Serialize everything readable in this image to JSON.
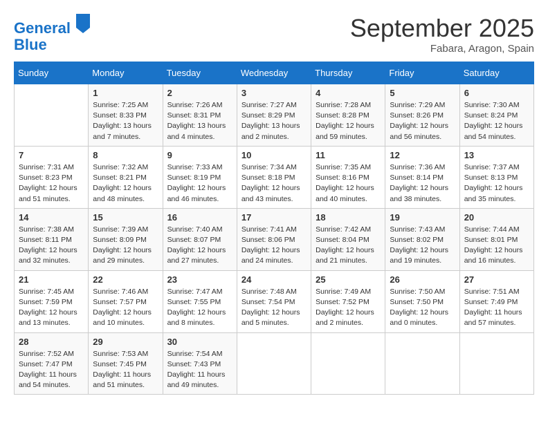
{
  "header": {
    "logo_line1": "General",
    "logo_line2": "Blue",
    "month": "September 2025",
    "location": "Fabara, Aragon, Spain"
  },
  "days_of_week": [
    "Sunday",
    "Monday",
    "Tuesday",
    "Wednesday",
    "Thursday",
    "Friday",
    "Saturday"
  ],
  "weeks": [
    [
      {
        "day": "",
        "info": ""
      },
      {
        "day": "1",
        "info": "Sunrise: 7:25 AM\nSunset: 8:33 PM\nDaylight: 13 hours\nand 7 minutes."
      },
      {
        "day": "2",
        "info": "Sunrise: 7:26 AM\nSunset: 8:31 PM\nDaylight: 13 hours\nand 4 minutes."
      },
      {
        "day": "3",
        "info": "Sunrise: 7:27 AM\nSunset: 8:29 PM\nDaylight: 13 hours\nand 2 minutes."
      },
      {
        "day": "4",
        "info": "Sunrise: 7:28 AM\nSunset: 8:28 PM\nDaylight: 12 hours\nand 59 minutes."
      },
      {
        "day": "5",
        "info": "Sunrise: 7:29 AM\nSunset: 8:26 PM\nDaylight: 12 hours\nand 56 minutes."
      },
      {
        "day": "6",
        "info": "Sunrise: 7:30 AM\nSunset: 8:24 PM\nDaylight: 12 hours\nand 54 minutes."
      }
    ],
    [
      {
        "day": "7",
        "info": "Sunrise: 7:31 AM\nSunset: 8:23 PM\nDaylight: 12 hours\nand 51 minutes."
      },
      {
        "day": "8",
        "info": "Sunrise: 7:32 AM\nSunset: 8:21 PM\nDaylight: 12 hours\nand 48 minutes."
      },
      {
        "day": "9",
        "info": "Sunrise: 7:33 AM\nSunset: 8:19 PM\nDaylight: 12 hours\nand 46 minutes."
      },
      {
        "day": "10",
        "info": "Sunrise: 7:34 AM\nSunset: 8:18 PM\nDaylight: 12 hours\nand 43 minutes."
      },
      {
        "day": "11",
        "info": "Sunrise: 7:35 AM\nSunset: 8:16 PM\nDaylight: 12 hours\nand 40 minutes."
      },
      {
        "day": "12",
        "info": "Sunrise: 7:36 AM\nSunset: 8:14 PM\nDaylight: 12 hours\nand 38 minutes."
      },
      {
        "day": "13",
        "info": "Sunrise: 7:37 AM\nSunset: 8:13 PM\nDaylight: 12 hours\nand 35 minutes."
      }
    ],
    [
      {
        "day": "14",
        "info": "Sunrise: 7:38 AM\nSunset: 8:11 PM\nDaylight: 12 hours\nand 32 minutes."
      },
      {
        "day": "15",
        "info": "Sunrise: 7:39 AM\nSunset: 8:09 PM\nDaylight: 12 hours\nand 29 minutes."
      },
      {
        "day": "16",
        "info": "Sunrise: 7:40 AM\nSunset: 8:07 PM\nDaylight: 12 hours\nand 27 minutes."
      },
      {
        "day": "17",
        "info": "Sunrise: 7:41 AM\nSunset: 8:06 PM\nDaylight: 12 hours\nand 24 minutes."
      },
      {
        "day": "18",
        "info": "Sunrise: 7:42 AM\nSunset: 8:04 PM\nDaylight: 12 hours\nand 21 minutes."
      },
      {
        "day": "19",
        "info": "Sunrise: 7:43 AM\nSunset: 8:02 PM\nDaylight: 12 hours\nand 19 minutes."
      },
      {
        "day": "20",
        "info": "Sunrise: 7:44 AM\nSunset: 8:01 PM\nDaylight: 12 hours\nand 16 minutes."
      }
    ],
    [
      {
        "day": "21",
        "info": "Sunrise: 7:45 AM\nSunset: 7:59 PM\nDaylight: 12 hours\nand 13 minutes."
      },
      {
        "day": "22",
        "info": "Sunrise: 7:46 AM\nSunset: 7:57 PM\nDaylight: 12 hours\nand 10 minutes."
      },
      {
        "day": "23",
        "info": "Sunrise: 7:47 AM\nSunset: 7:55 PM\nDaylight: 12 hours\nand 8 minutes."
      },
      {
        "day": "24",
        "info": "Sunrise: 7:48 AM\nSunset: 7:54 PM\nDaylight: 12 hours\nand 5 minutes."
      },
      {
        "day": "25",
        "info": "Sunrise: 7:49 AM\nSunset: 7:52 PM\nDaylight: 12 hours\nand 2 minutes."
      },
      {
        "day": "26",
        "info": "Sunrise: 7:50 AM\nSunset: 7:50 PM\nDaylight: 12 hours\nand 0 minutes."
      },
      {
        "day": "27",
        "info": "Sunrise: 7:51 AM\nSunset: 7:49 PM\nDaylight: 11 hours\nand 57 minutes."
      }
    ],
    [
      {
        "day": "28",
        "info": "Sunrise: 7:52 AM\nSunset: 7:47 PM\nDaylight: 11 hours\nand 54 minutes."
      },
      {
        "day": "29",
        "info": "Sunrise: 7:53 AM\nSunset: 7:45 PM\nDaylight: 11 hours\nand 51 minutes."
      },
      {
        "day": "30",
        "info": "Sunrise: 7:54 AM\nSunset: 7:43 PM\nDaylight: 11 hours\nand 49 minutes."
      },
      {
        "day": "",
        "info": ""
      },
      {
        "day": "",
        "info": ""
      },
      {
        "day": "",
        "info": ""
      },
      {
        "day": "",
        "info": ""
      }
    ]
  ]
}
